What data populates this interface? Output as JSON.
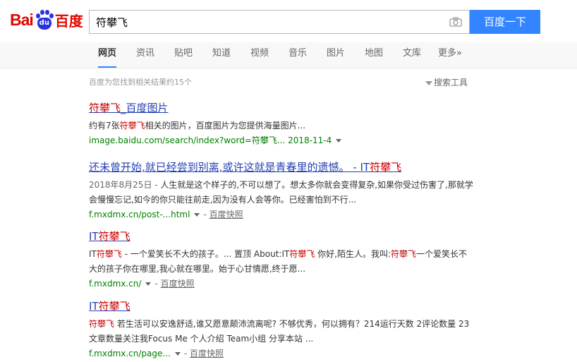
{
  "logo": {
    "left": "Bai",
    "paw": "du",
    "right": "百度"
  },
  "search": {
    "query": "符攀飞",
    "button_label": "百度一下"
  },
  "nav": {
    "items": [
      "网页",
      "资讯",
      "贴吧",
      "知道",
      "视频",
      "音乐",
      "图片",
      "地图",
      "文库",
      "更多»"
    ],
    "active_index": 0
  },
  "result_count": "百度为您找到相关结果约15个",
  "search_tools": "搜索工具",
  "results": [
    {
      "title": [
        {
          "t": "符攀飞",
          "h": true
        },
        {
          "t": "_百度图片",
          "h": false
        }
      ],
      "abstract": [
        {
          "t": "约有7张",
          "h": false
        },
        {
          "t": "符攀飞",
          "h": true
        },
        {
          "t": "相关的图片，百度图片为您提供海量图片...",
          "h": false
        }
      ],
      "url": "image.baidu.com/search/index?word=符攀飞... 2018-11-4",
      "snapshot": ""
    },
    {
      "title": [
        {
          "t": "还未曾开始,就已经尝到别离,或许这就是青春里的遗憾。 - IT",
          "h": false
        },
        {
          "t": "符攀飞",
          "h": true
        }
      ],
      "date": "2018年8月25日 - ",
      "abstract": [
        {
          "t": "人生就是这个样子的,不可以想了。想太多你就会变得复杂,如果你受过伤害了,那就学会慢慢忘记,如今的你只能往前走,因为没有人会等你。已经害怕到不行...",
          "h": false
        }
      ],
      "url": "f.mxdmx.cn/post-...html",
      "snapshot": "百度快照"
    },
    {
      "title": [
        {
          "t": "IT",
          "h": false
        },
        {
          "t": "符攀飞",
          "h": true
        }
      ],
      "abstract": [
        {
          "t": "IT",
          "h": false
        },
        {
          "t": "符攀飞",
          "h": true
        },
        {
          "t": " - 一个爱笑长不大的孩子。... 置顶 About:IT",
          "h": false
        },
        {
          "t": "符攀飞",
          "h": true
        },
        {
          "t": " 你好,陌生人。我叫:",
          "h": false
        },
        {
          "t": "符攀飞",
          "h": true
        },
        {
          "t": "一个爱笑长不大的孩子你在哪里,我心就在哪里。始于心甘情愿,终于愿...",
          "h": false
        }
      ],
      "url": "f.mxdmx.cn/",
      "snapshot": "百度快照"
    },
    {
      "title": [
        {
          "t": "IT",
          "h": false
        },
        {
          "t": "符攀飞",
          "h": true
        }
      ],
      "abstract": [
        {
          "t": "符攀飞",
          "h": true
        },
        {
          "t": " 若生活可以安逸舒适,谁又愿意颠沛流离呢? 不够优秀，何以拥有？214运行天数 2评论数量 23文章数量关注我Focus Me 个人介绍 Team小组 分享本站 ...",
          "h": false
        }
      ],
      "url": "f.mxdmx.cn/page...",
      "snapshot": "百度快照"
    }
  ],
  "colors": {
    "brand_red": "#e10601",
    "brand_blue": "#2932e1",
    "button_blue": "#3385ff",
    "link_blue": "#2440b3",
    "highlight_red": "#cc0000",
    "url_green": "#008000"
  },
  "icons": [
    "camera-icon",
    "filter-icon",
    "dropdown-arrow-icon"
  ]
}
